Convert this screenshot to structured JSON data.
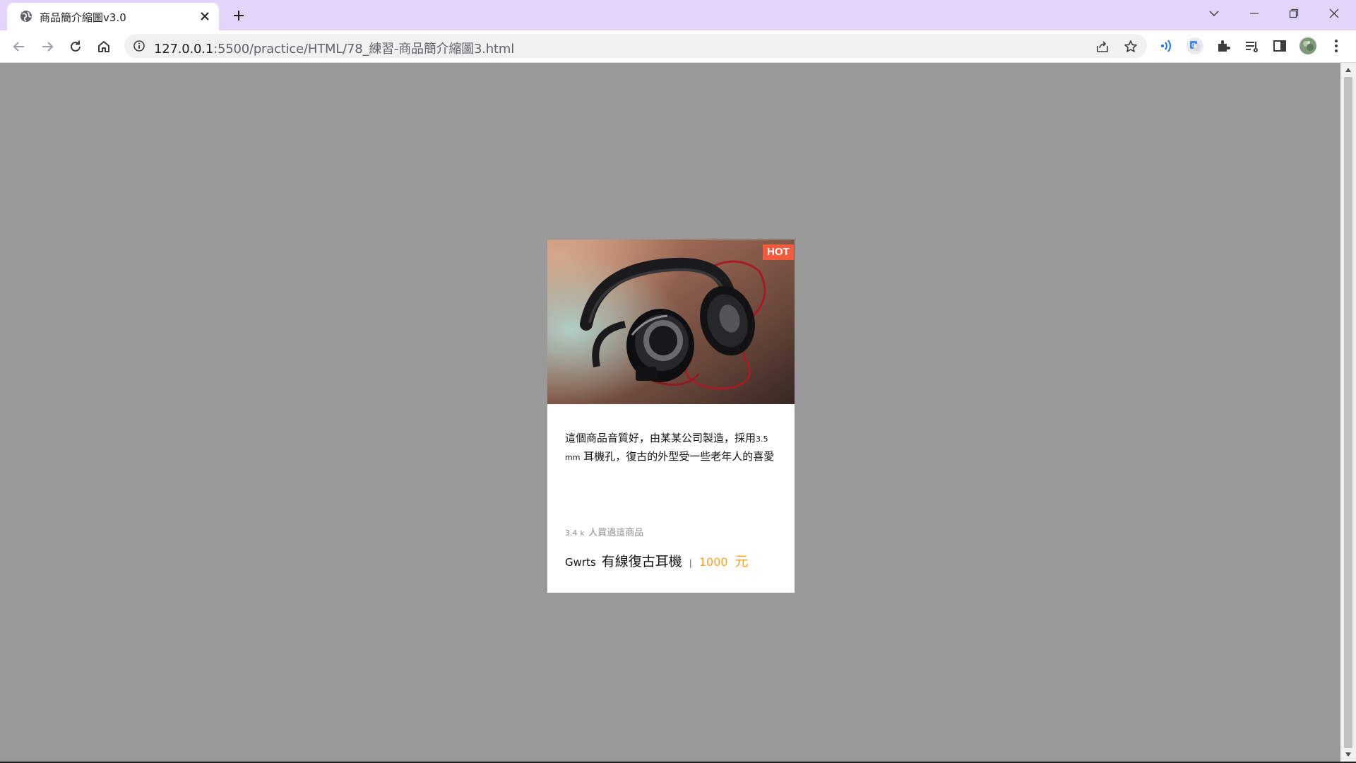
{
  "browser": {
    "tab_title": "商品簡介縮圖v3.0",
    "url_host": "127.0.0.1",
    "url_path": ":5500/practice/HTML/78_練習-商品簡介縮圖3.html",
    "accent_color": "#e3d4f9"
  },
  "card": {
    "badge": "HOT",
    "image_subject": "headphones-photo",
    "desc_1": "這個商品音質好，由某某公司製造，採用",
    "desc_num": "3.5",
    "desc_unit": "mm",
    "desc_2": "耳機孔，復古的外型受一些老年人的喜愛",
    "sold_num": "3.4",
    "sold_unit": "k",
    "sold_text": "人買過這商品",
    "brand": "Gwrts",
    "product_name": "有線復古耳機",
    "separator": "|",
    "price": "1000",
    "currency": "元",
    "badge_color": "#f45b3c",
    "price_color": "#ff9f1a"
  }
}
